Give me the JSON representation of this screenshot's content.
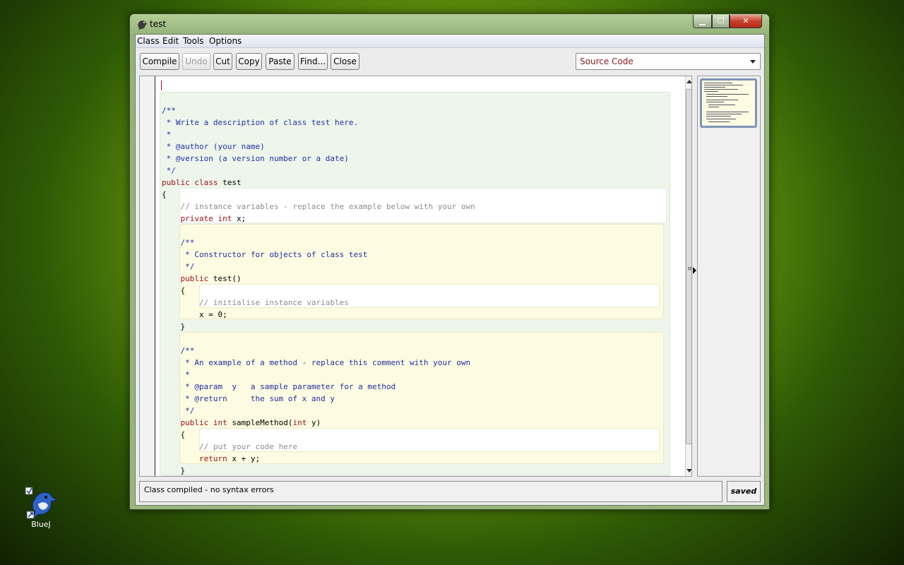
{
  "window": {
    "title": "test"
  },
  "menu": [
    "Class",
    "Edit",
    "Tools",
    "Options"
  ],
  "toolbar": {
    "compile": "Compile",
    "undo": "Undo",
    "cut": "Cut",
    "copy": "Copy",
    "paste": "Paste",
    "find": "Find...",
    "close": "Close"
  },
  "view_select": {
    "selected": "Source Code"
  },
  "code_lines": [
    [],
    [
      {
        "t": "/**",
        "c": "cm"
      }
    ],
    [
      {
        "t": " * Write a description of class test here.",
        "c": "cm"
      }
    ],
    [
      {
        "t": " *",
        "c": "cm"
      }
    ],
    [
      {
        "t": " * @author (your name)",
        "c": "cm"
      }
    ],
    [
      {
        "t": " * @version (a version number or a date)",
        "c": "cm"
      }
    ],
    [
      {
        "t": " */",
        "c": "cm"
      }
    ],
    [
      {
        "t": "public ",
        "c": "kw"
      },
      {
        "t": "class ",
        "c": "kw"
      },
      {
        "t": "test",
        "c": "pl"
      }
    ],
    [
      {
        "t": "{",
        "c": "pl"
      }
    ],
    [
      {
        "t": "    // instance variables - replace the example below with your own",
        "c": "lc"
      }
    ],
    [
      {
        "t": "    private ",
        "c": "kw"
      },
      {
        "t": "int ",
        "c": "kw"
      },
      {
        "t": "x;",
        "c": "pl"
      }
    ],
    [],
    [
      {
        "t": "    /**",
        "c": "cm"
      }
    ],
    [
      {
        "t": "     * Constructor for objects of class test",
        "c": "cm"
      }
    ],
    [
      {
        "t": "     */",
        "c": "cm"
      }
    ],
    [
      {
        "t": "    public ",
        "c": "kw"
      },
      {
        "t": "test()",
        "c": "pl"
      }
    ],
    [
      {
        "t": "    {",
        "c": "pl"
      }
    ],
    [
      {
        "t": "        // initialise instance variables",
        "c": "lc"
      }
    ],
    [
      {
        "t": "        x = 0;",
        "c": "pl"
      }
    ],
    [
      {
        "t": "    }",
        "c": "pl"
      }
    ],
    [],
    [
      {
        "t": "    /**",
        "c": "cm"
      }
    ],
    [
      {
        "t": "     * An example of a method - replace this comment with your own",
        "c": "cm"
      }
    ],
    [
      {
        "t": "     *",
        "c": "cm"
      }
    ],
    [
      {
        "t": "     * @param  y   a sample parameter for a method",
        "c": "cm"
      }
    ],
    [
      {
        "t": "     * @return     the sum of x and y",
        "c": "cm"
      }
    ],
    [
      {
        "t": "     */",
        "c": "cm"
      }
    ],
    [
      {
        "t": "    public ",
        "c": "kw"
      },
      {
        "t": "int ",
        "c": "kw"
      },
      {
        "t": "sampleMethod(",
        "c": "pl"
      },
      {
        "t": "int ",
        "c": "kw"
      },
      {
        "t": "y)",
        "c": "pl"
      }
    ],
    [
      {
        "t": "    {",
        "c": "pl"
      }
    ],
    [
      {
        "t": "        // put your code here",
        "c": "lc"
      }
    ],
    [
      {
        "t": "        return ",
        "c": "kw"
      },
      {
        "t": "x + y;",
        "c": "pl"
      }
    ],
    [
      {
        "t": "    }",
        "c": "pl"
      }
    ],
    [
      {
        "t": "}",
        "c": "pl"
      }
    ]
  ],
  "status": {
    "message": "Class compiled - no syntax errors",
    "saved": "saved"
  },
  "desktop": {
    "icon_label": "BlueJ"
  }
}
